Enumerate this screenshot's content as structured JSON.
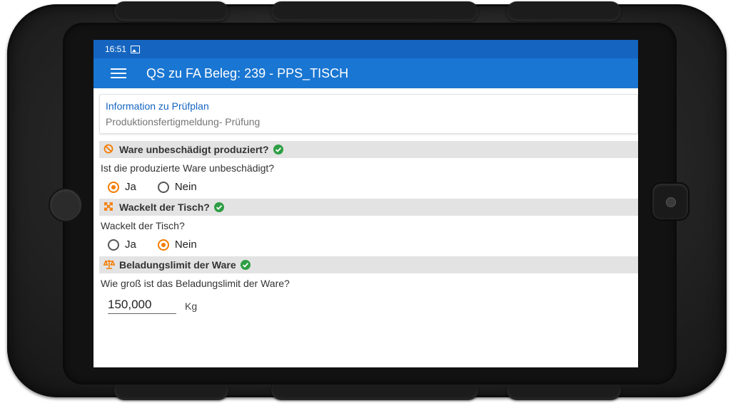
{
  "status": {
    "time": "16:51",
    "notification_icon": "image-icon"
  },
  "appbar": {
    "menu_icon": "menu-icon",
    "title": "QS zu FA Beleg: 239 - PPS_TISCH"
  },
  "info": {
    "title": "Information zu Prüfplan",
    "subtitle": "Produktionsfertigmeldung- Prüfung"
  },
  "sections": [
    {
      "icon": "no-damage-icon",
      "title": "Ware unbeschädigt produziert?",
      "status_icon": "check-circle-icon",
      "question": "Ist die produzierte Ware unbeschädigt?",
      "options": [
        "Ja",
        "Nein"
      ],
      "selected": "Ja"
    },
    {
      "icon": "wobble-icon",
      "title": "Wackelt der Tisch?",
      "status_icon": "check-circle-icon",
      "question": "Wackelt der Tisch?",
      "options": [
        "Ja",
        "Nein"
      ],
      "selected": "Nein"
    },
    {
      "icon": "scale-icon",
      "title": "Beladungslimit der Ware",
      "status_icon": "check-circle-icon",
      "question": "Wie groß ist das Beladungslimit der Ware?",
      "value": "150,000",
      "unit": "Kg"
    }
  ],
  "colors": {
    "statusbar": "#1565C0",
    "appbar": "#1976D2",
    "accent": "#F57C00",
    "check": "#2E9E44",
    "section_header_bg": "#E3E3E3"
  }
}
